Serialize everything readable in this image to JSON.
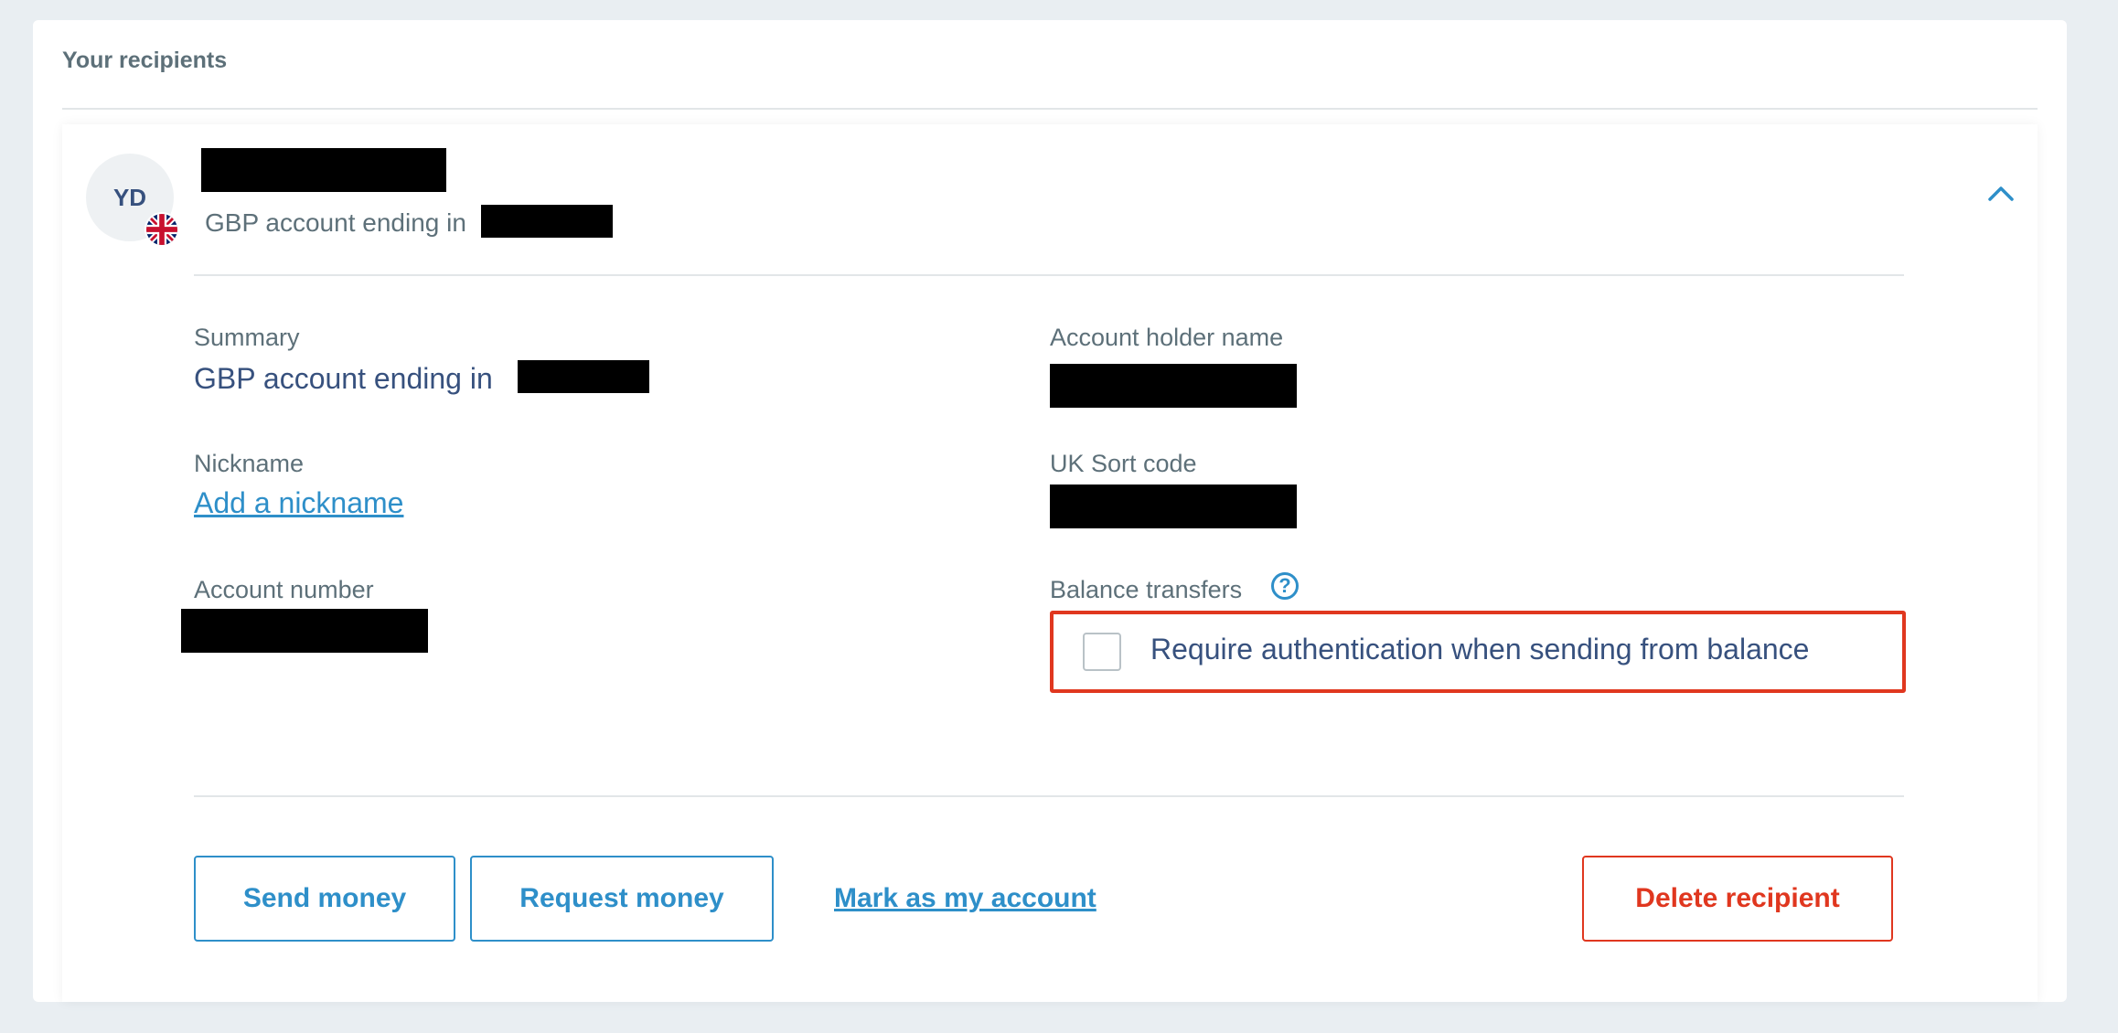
{
  "section_title": "Your recipients",
  "recipient": {
    "avatar_initials": "YD",
    "flag_icon": "uk-flag-icon",
    "subtitle": "GBP account ending in",
    "summary_label": "Summary",
    "summary_value": "GBP account ending in",
    "nickname_label": "Nickname",
    "nickname_link": "Add a nickname",
    "account_number_label": "Account number",
    "account_holder_label": "Account holder name",
    "sort_code_label": "UK Sort code",
    "balance_transfers_label": "Balance transfers",
    "help_icon": "?",
    "auth_checkbox_label": "Require authentication when sending from balance",
    "auth_checked": false
  },
  "actions": {
    "send_money": "Send money",
    "request_money": "Request money",
    "mark_as_my_account": "Mark as my account",
    "delete_recipient": "Delete recipient"
  },
  "colors": {
    "accent": "#2e8fc9",
    "danger": "#e0371f",
    "text_primary": "#37517e",
    "text_secondary": "#5d7079"
  }
}
